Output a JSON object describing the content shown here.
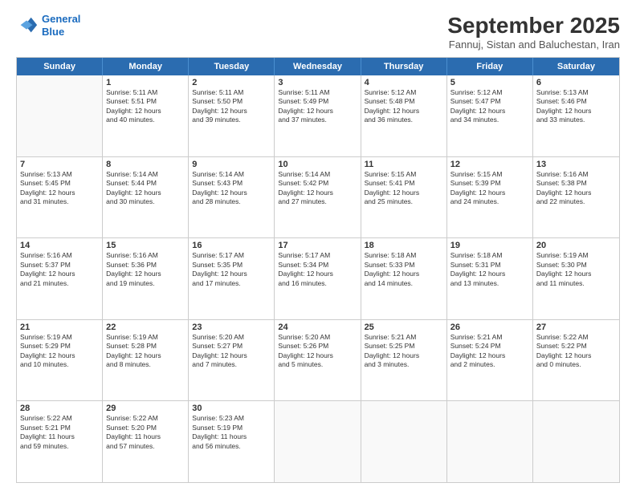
{
  "logo": {
    "line1": "General",
    "line2": "Blue"
  },
  "title": "September 2025",
  "subtitle": "Fannuj, Sistan and Baluchestan, Iran",
  "header_days": [
    "Sunday",
    "Monday",
    "Tuesday",
    "Wednesday",
    "Thursday",
    "Friday",
    "Saturday"
  ],
  "weeks": [
    [
      {
        "day": "",
        "info": ""
      },
      {
        "day": "1",
        "info": "Sunrise: 5:11 AM\nSunset: 5:51 PM\nDaylight: 12 hours\nand 40 minutes."
      },
      {
        "day": "2",
        "info": "Sunrise: 5:11 AM\nSunset: 5:50 PM\nDaylight: 12 hours\nand 39 minutes."
      },
      {
        "day": "3",
        "info": "Sunrise: 5:11 AM\nSunset: 5:49 PM\nDaylight: 12 hours\nand 37 minutes."
      },
      {
        "day": "4",
        "info": "Sunrise: 5:12 AM\nSunset: 5:48 PM\nDaylight: 12 hours\nand 36 minutes."
      },
      {
        "day": "5",
        "info": "Sunrise: 5:12 AM\nSunset: 5:47 PM\nDaylight: 12 hours\nand 34 minutes."
      },
      {
        "day": "6",
        "info": "Sunrise: 5:13 AM\nSunset: 5:46 PM\nDaylight: 12 hours\nand 33 minutes."
      }
    ],
    [
      {
        "day": "7",
        "info": "Sunrise: 5:13 AM\nSunset: 5:45 PM\nDaylight: 12 hours\nand 31 minutes."
      },
      {
        "day": "8",
        "info": "Sunrise: 5:14 AM\nSunset: 5:44 PM\nDaylight: 12 hours\nand 30 minutes."
      },
      {
        "day": "9",
        "info": "Sunrise: 5:14 AM\nSunset: 5:43 PM\nDaylight: 12 hours\nand 28 minutes."
      },
      {
        "day": "10",
        "info": "Sunrise: 5:14 AM\nSunset: 5:42 PM\nDaylight: 12 hours\nand 27 minutes."
      },
      {
        "day": "11",
        "info": "Sunrise: 5:15 AM\nSunset: 5:41 PM\nDaylight: 12 hours\nand 25 minutes."
      },
      {
        "day": "12",
        "info": "Sunrise: 5:15 AM\nSunset: 5:39 PM\nDaylight: 12 hours\nand 24 minutes."
      },
      {
        "day": "13",
        "info": "Sunrise: 5:16 AM\nSunset: 5:38 PM\nDaylight: 12 hours\nand 22 minutes."
      }
    ],
    [
      {
        "day": "14",
        "info": "Sunrise: 5:16 AM\nSunset: 5:37 PM\nDaylight: 12 hours\nand 21 minutes."
      },
      {
        "day": "15",
        "info": "Sunrise: 5:16 AM\nSunset: 5:36 PM\nDaylight: 12 hours\nand 19 minutes."
      },
      {
        "day": "16",
        "info": "Sunrise: 5:17 AM\nSunset: 5:35 PM\nDaylight: 12 hours\nand 17 minutes."
      },
      {
        "day": "17",
        "info": "Sunrise: 5:17 AM\nSunset: 5:34 PM\nDaylight: 12 hours\nand 16 minutes."
      },
      {
        "day": "18",
        "info": "Sunrise: 5:18 AM\nSunset: 5:33 PM\nDaylight: 12 hours\nand 14 minutes."
      },
      {
        "day": "19",
        "info": "Sunrise: 5:18 AM\nSunset: 5:31 PM\nDaylight: 12 hours\nand 13 minutes."
      },
      {
        "day": "20",
        "info": "Sunrise: 5:19 AM\nSunset: 5:30 PM\nDaylight: 12 hours\nand 11 minutes."
      }
    ],
    [
      {
        "day": "21",
        "info": "Sunrise: 5:19 AM\nSunset: 5:29 PM\nDaylight: 12 hours\nand 10 minutes."
      },
      {
        "day": "22",
        "info": "Sunrise: 5:19 AM\nSunset: 5:28 PM\nDaylight: 12 hours\nand 8 minutes."
      },
      {
        "day": "23",
        "info": "Sunrise: 5:20 AM\nSunset: 5:27 PM\nDaylight: 12 hours\nand 7 minutes."
      },
      {
        "day": "24",
        "info": "Sunrise: 5:20 AM\nSunset: 5:26 PM\nDaylight: 12 hours\nand 5 minutes."
      },
      {
        "day": "25",
        "info": "Sunrise: 5:21 AM\nSunset: 5:25 PM\nDaylight: 12 hours\nand 3 minutes."
      },
      {
        "day": "26",
        "info": "Sunrise: 5:21 AM\nSunset: 5:24 PM\nDaylight: 12 hours\nand 2 minutes."
      },
      {
        "day": "27",
        "info": "Sunrise: 5:22 AM\nSunset: 5:22 PM\nDaylight: 12 hours\nand 0 minutes."
      }
    ],
    [
      {
        "day": "28",
        "info": "Sunrise: 5:22 AM\nSunset: 5:21 PM\nDaylight: 11 hours\nand 59 minutes."
      },
      {
        "day": "29",
        "info": "Sunrise: 5:22 AM\nSunset: 5:20 PM\nDaylight: 11 hours\nand 57 minutes."
      },
      {
        "day": "30",
        "info": "Sunrise: 5:23 AM\nSunset: 5:19 PM\nDaylight: 11 hours\nand 56 minutes."
      },
      {
        "day": "",
        "info": ""
      },
      {
        "day": "",
        "info": ""
      },
      {
        "day": "",
        "info": ""
      },
      {
        "day": "",
        "info": ""
      }
    ]
  ]
}
